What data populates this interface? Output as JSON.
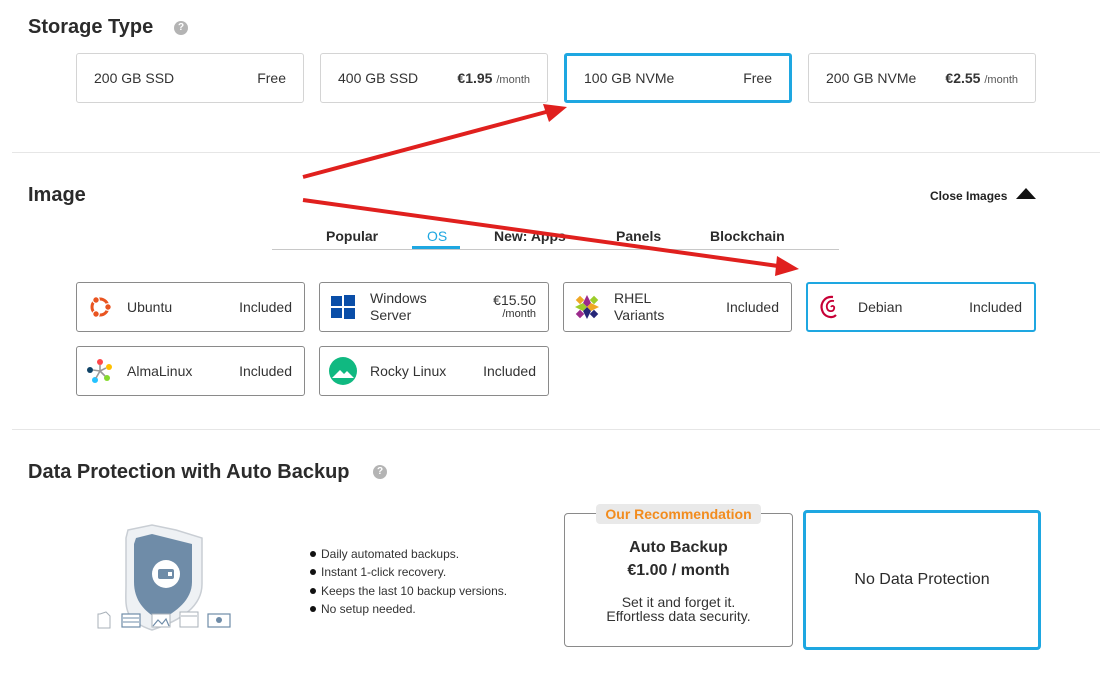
{
  "storage": {
    "title": "Storage Type",
    "help": "?",
    "options": [
      {
        "name": "200 GB SSD",
        "price": "Free",
        "per": ""
      },
      {
        "name": "400 GB SSD",
        "price": "€1.95",
        "per": "/month"
      },
      {
        "name": "100 GB NVMe",
        "price": "Free",
        "per": "",
        "selected": true
      },
      {
        "name": "200 GB NVMe",
        "price": "€2.55",
        "per": "/month"
      }
    ]
  },
  "image": {
    "title": "Image",
    "close_label": "Close Images",
    "tabs": [
      "Popular",
      "OS",
      "New: Apps",
      "Panels",
      "Blockchain"
    ],
    "active_tab": "OS",
    "os": [
      {
        "name": "Ubuntu",
        "price": "Included",
        "icon": "ubuntu-logo"
      },
      {
        "name1": "Windows",
        "name2": "Server",
        "price": "€15.50",
        "per": "/month",
        "icon": "windows-logo"
      },
      {
        "name1": "RHEL",
        "name2": "Variants",
        "price": "Included",
        "icon": "rhel-logo"
      },
      {
        "name": "Debian",
        "price": "Included",
        "icon": "debian-logo",
        "selected": true
      },
      {
        "name": "AlmaLinux",
        "price": "Included",
        "icon": "almalinux-logo"
      },
      {
        "name": "Rocky Linux",
        "price": "Included",
        "icon": "rocky-linux-logo"
      }
    ]
  },
  "backup": {
    "title": "Data Protection with Auto Backup",
    "help": "?",
    "bullets": [
      "Daily automated backups.",
      "Instant 1-click recovery.",
      "Keeps the last 10 backup versions.",
      "No setup needed."
    ],
    "recommendation_badge": "Our Recommendation",
    "auto_backup": {
      "title": "Auto Backup",
      "price": "€1.00 / month",
      "desc1": "Set it and forget it.",
      "desc2": "Effortless data security."
    },
    "no_protection": "No Data Protection"
  },
  "colors": {
    "accent": "#1ea7e1",
    "recommendation": "#f28c1e",
    "annotation_arrow": "#e0201e"
  }
}
